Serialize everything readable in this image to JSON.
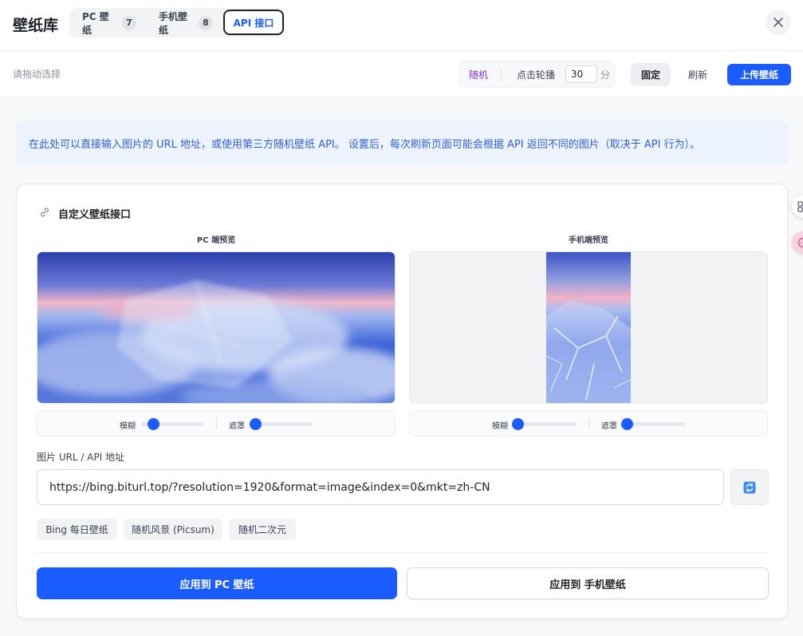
{
  "header": {
    "title": "壁纸库",
    "tabs": [
      {
        "label": "PC 壁纸",
        "count": "7"
      },
      {
        "label": "手机壁纸",
        "count": "8"
      },
      {
        "label": "API 接口"
      }
    ]
  },
  "toolbar": {
    "drag_hint": "请拖动选择",
    "random_label": "随机",
    "carousel_label": "点击轮播",
    "interval_value": "30",
    "interval_unit": "分",
    "fix_label": "固定",
    "refresh_label": "刷新",
    "upload_label": "上传壁纸"
  },
  "info": {
    "text": "在此处可以直接输入图片的 URL 地址，或使用第三方随机壁纸 API。 设置后，每次刷新页面可能会根据 API 返回不同的图片（取决于 API 行为）。"
  },
  "card": {
    "title": "自定义壁纸接口",
    "pc_preview_label": "PC 端预览",
    "mobile_preview_label": "手机端预览",
    "pc_sliders": {
      "blur_label": "模糊",
      "blur_value": 0.1,
      "mask_label": "遮罩",
      "mask_value": 0.06
    },
    "mobile_sliders": {
      "blur_label": "模糊",
      "blur_value": 0.02,
      "mask_label": "遮罩",
      "mask_value": 0.02
    },
    "url_label": "图片 URL / API 地址",
    "url_value": "https://bing.biturl.top/?resolution=1920&format=image&index=0&mkt=zh-CN",
    "presets": [
      "Bing 每日壁纸",
      "随机风景 (Picsum)",
      "随机二次元"
    ],
    "apply_pc": "应用到 PC 壁纸",
    "apply_mobile": "应用到 手机壁纸"
  },
  "colors": {
    "accent": "#1a5cff",
    "random_link": "#8b2fd6",
    "info_text": "#2f5fd6",
    "info_bg": "#eef4ff"
  },
  "icons": {
    "close": "close-icon",
    "link": "link-icon",
    "url_refresh": "refresh-icon",
    "side_grid": "grid-icon",
    "side_pink": "chat-icon"
  }
}
